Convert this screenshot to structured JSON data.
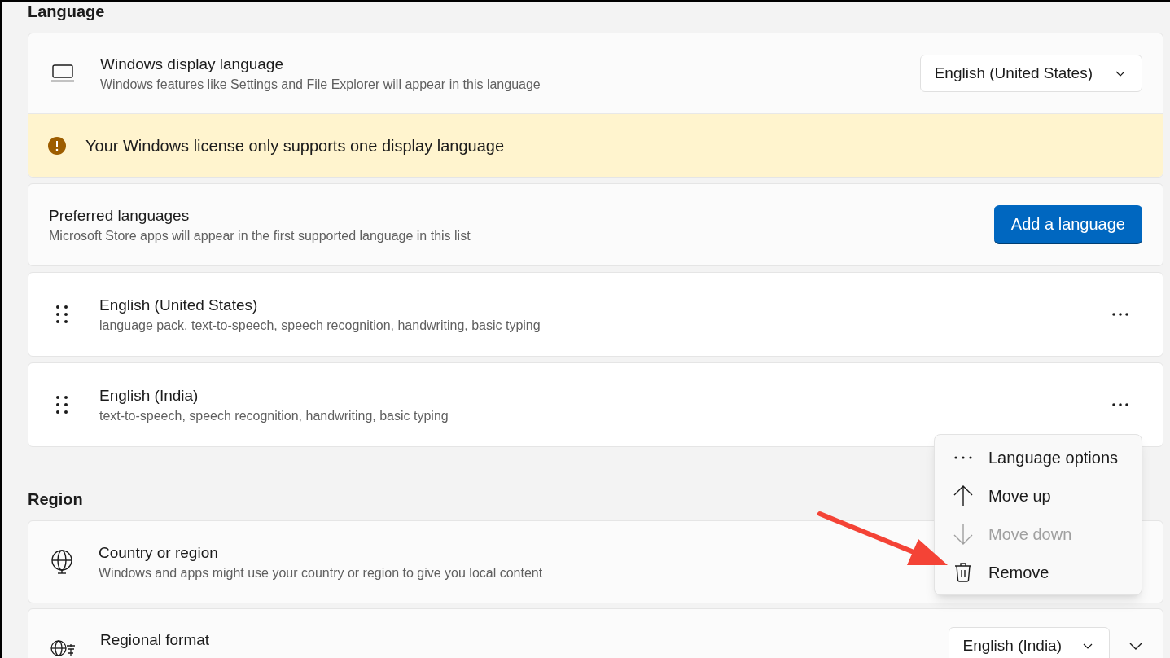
{
  "language": {
    "heading": "Language",
    "display_language": {
      "title": "Windows display language",
      "subtitle": "Windows features like Settings and File Explorer will appear in this language",
      "value": "English (United States)",
      "notice": "Your Windows license only supports one display language"
    },
    "preferred": {
      "title": "Preferred languages",
      "subtitle": "Microsoft Store apps will appear in the first supported language in this list",
      "button": "Add a language"
    },
    "languages": [
      {
        "name": "English (United States)",
        "features": "language pack, text-to-speech, speech recognition, handwriting, basic typing"
      },
      {
        "name": "English (India)",
        "features": "text-to-speech, speech recognition, handwriting, basic typing"
      }
    ]
  },
  "region": {
    "heading": "Region",
    "items": [
      {
        "kind": "plain",
        "title": "Country or region",
        "subtitle": "Windows and apps might use your country or region to give you local content"
      },
      {
        "kind": "dropdown",
        "title": "Regional format",
        "value": "English (India)"
      }
    ]
  },
  "context_menu": {
    "items": [
      {
        "kind": "options",
        "label": "Language options",
        "disabled": false
      },
      {
        "kind": "up",
        "label": "Move up",
        "disabled": false
      },
      {
        "kind": "down",
        "label": "Move down",
        "disabled": true
      },
      {
        "kind": "remove",
        "label": "Remove",
        "disabled": false
      }
    ]
  }
}
